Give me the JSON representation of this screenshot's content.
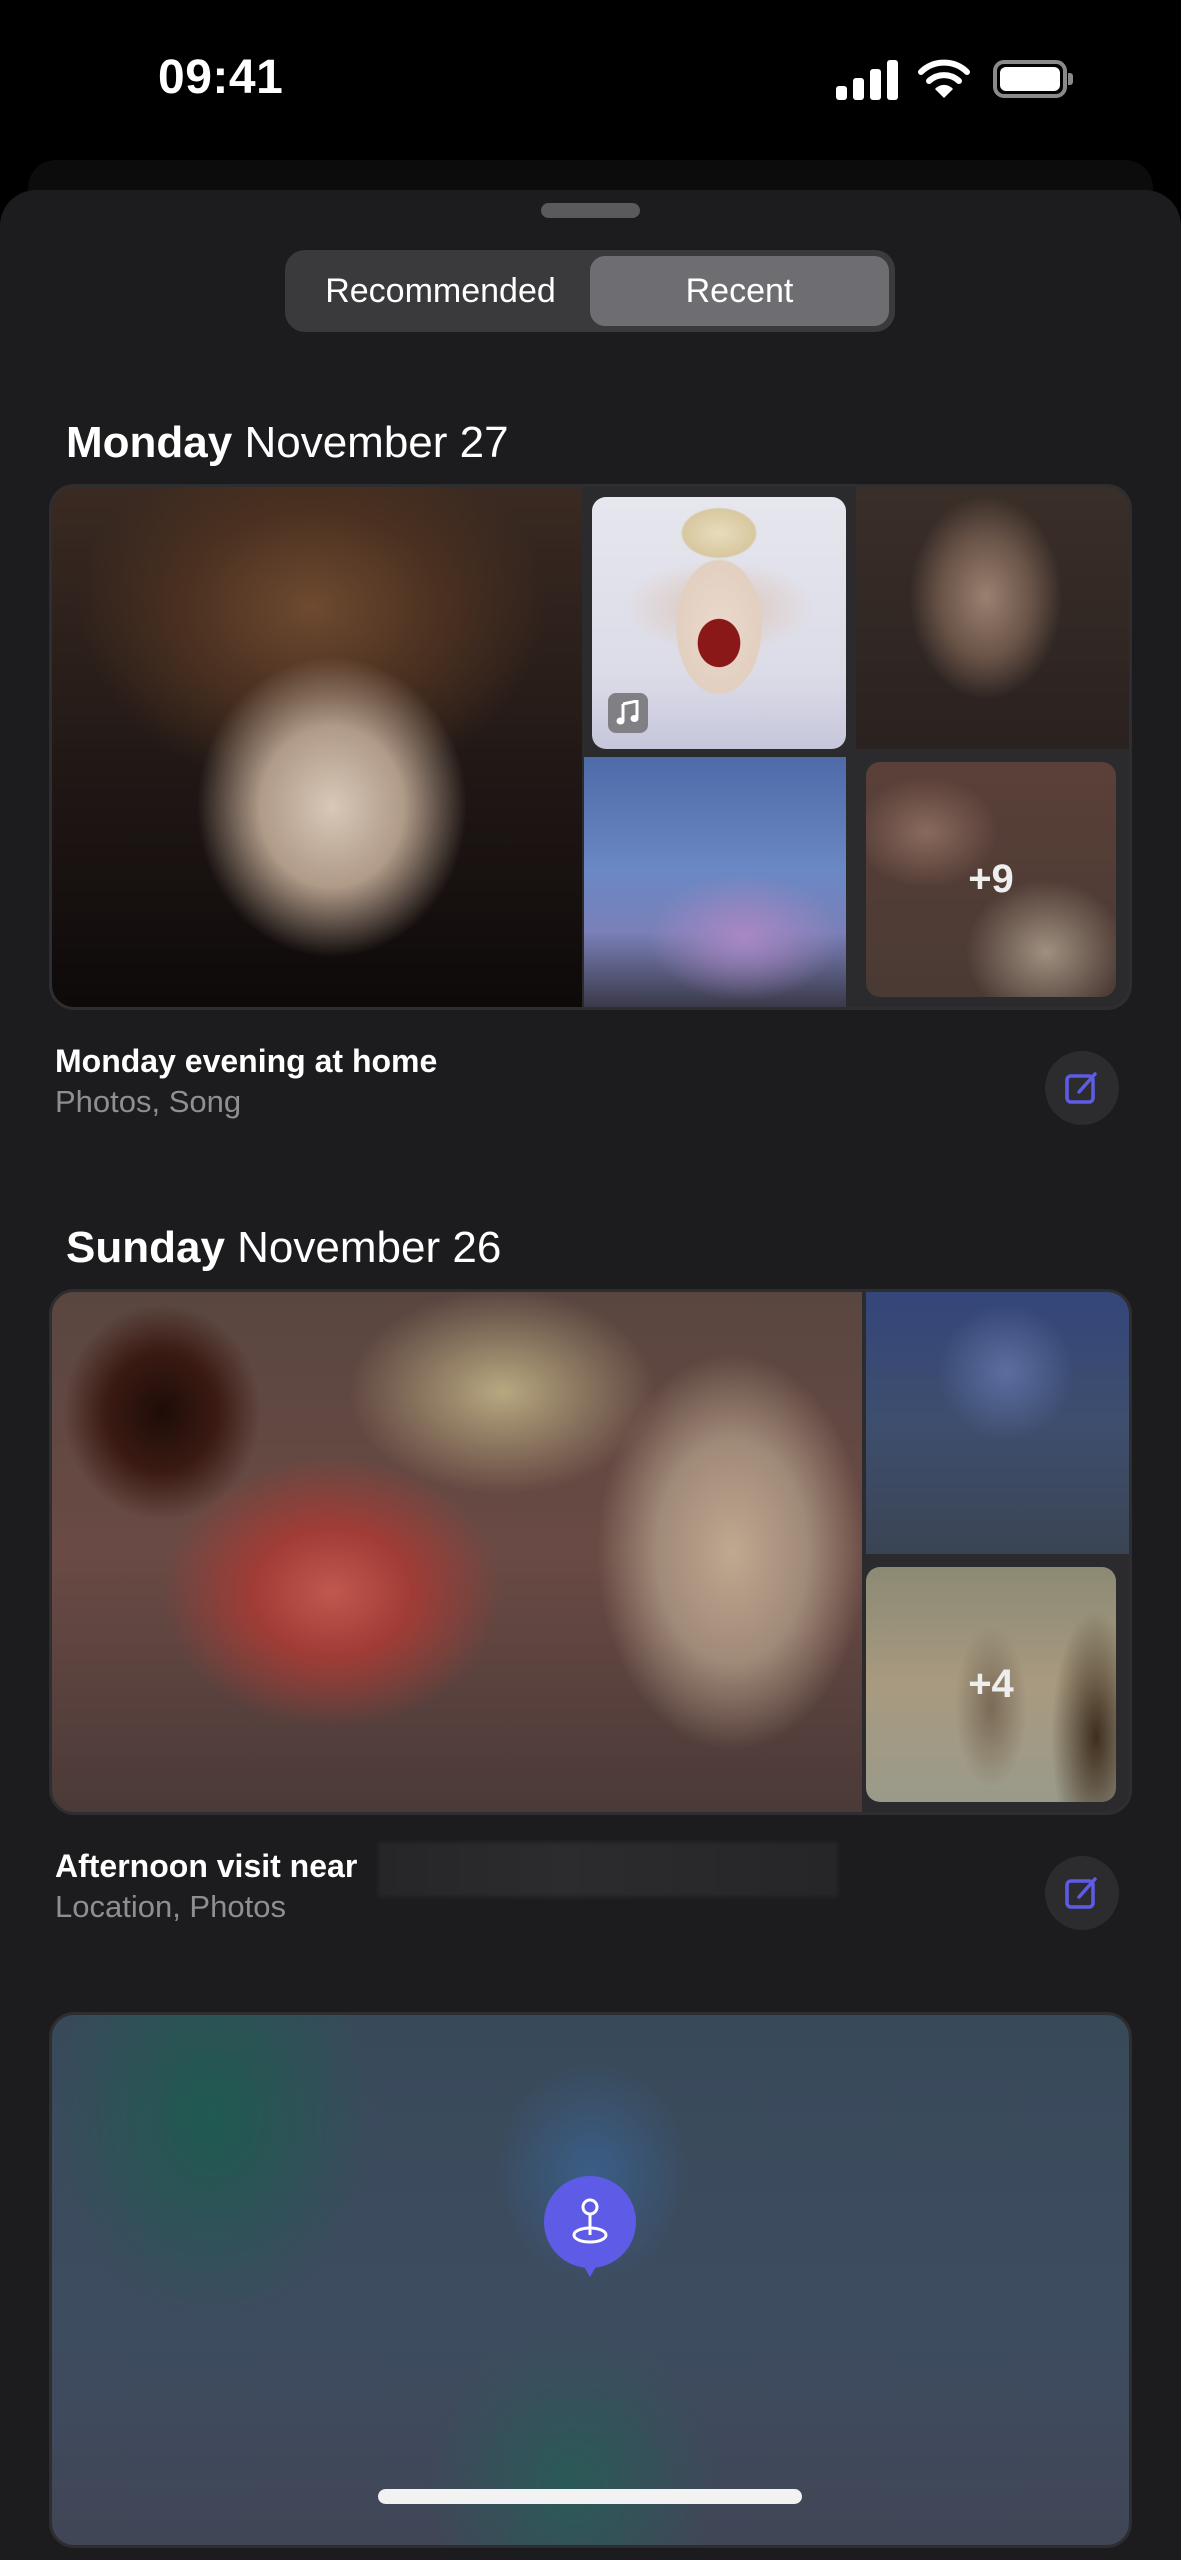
{
  "status_bar": {
    "time": "09:41",
    "signal_icon": "cellular-signal-icon",
    "wifi_icon": "wifi-icon",
    "battery_icon": "battery-full-icon"
  },
  "segmented_control": {
    "options": [
      {
        "label": "Recommended",
        "selected": false
      },
      {
        "label": "Recent",
        "selected": true
      }
    ]
  },
  "days": [
    {
      "weekday": "Monday",
      "date": "November 27",
      "entry": {
        "title": "Monday evening at home",
        "subtitle": "Photos, Song",
        "more_count": "+9",
        "song_badge_icon": "music-note-icon",
        "edit_icon": "edit-icon"
      }
    },
    {
      "weekday": "Sunday",
      "date": "November 26",
      "entry": {
        "title": "Afternoon visit near",
        "subtitle": "Location, Photos",
        "more_count": "+4",
        "edit_icon": "edit-icon"
      }
    }
  ],
  "map_card": {
    "pin_icon": "location-pin-icon"
  },
  "colors": {
    "accent": "#5E5CE6",
    "sheet_background": "#1C1C1E",
    "secondary_text": "#8E8E93"
  }
}
